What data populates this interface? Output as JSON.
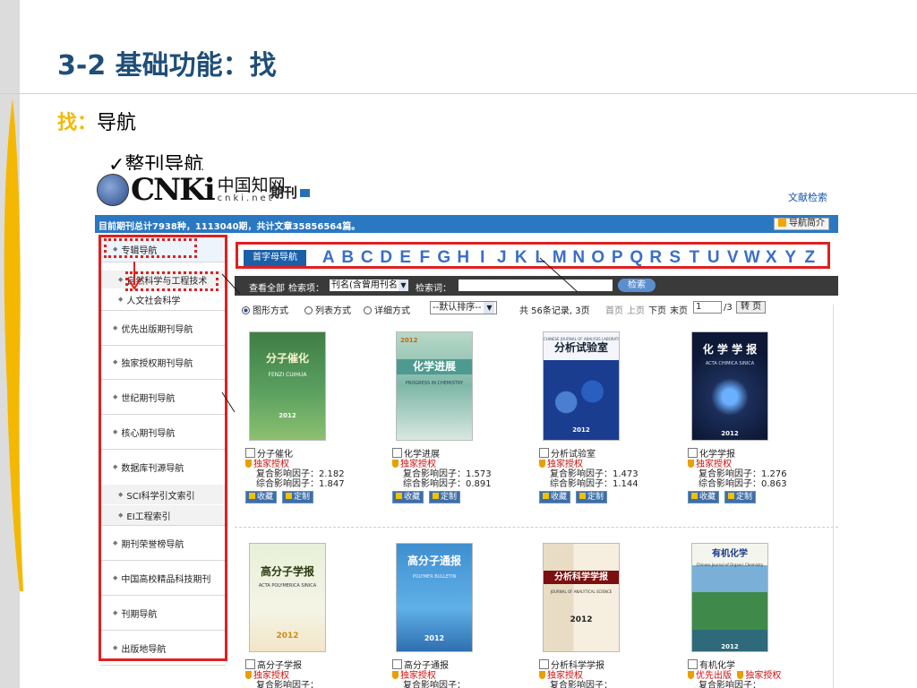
{
  "slide": {
    "title": "3-2 基础功能：找",
    "subtitle_hl": "找：",
    "subtitle": "导航",
    "check_item": "✓整刊导航"
  },
  "colors": {
    "title": "#1f4e79",
    "accent": "#f5b800",
    "annotation": "#e02020",
    "bar": "#2a78c2"
  },
  "header": {
    "logo_text": "CNKi",
    "logo_cn": "中国知网",
    "logo_url": "cnki.net",
    "section": "期刊",
    "doc_search": "文献检索",
    "stats": "目前期刊总计7938种，1113040期，共计文章35856564篇。",
    "guide_intro": "导航简介"
  },
  "sidebar": {
    "items": [
      {
        "label": "专辑导航"
      },
      {
        "label": "自然科学与工程技术"
      },
      {
        "label": "人文社会科学"
      },
      {
        "label": "优先出版期刊导航"
      },
      {
        "label": "独家授权期刊导航"
      },
      {
        "label": "世纪期刊导航"
      },
      {
        "label": "核心期刊导航"
      },
      {
        "label": "数据库刊源导航"
      },
      {
        "label": "SCI科学引文索引"
      },
      {
        "label": "EI工程索引"
      },
      {
        "label": "期刊荣誉榜导航"
      },
      {
        "label": "中国高校精品科技期刊"
      },
      {
        "label": "刊期导航"
      },
      {
        "label": "出版地导航"
      }
    ]
  },
  "letters": {
    "first_label": "首字母导航",
    "list": [
      "A",
      "B",
      "C",
      "D",
      "E",
      "F",
      "G",
      "H",
      "I",
      "J",
      "K",
      "L",
      "M",
      "N",
      "O",
      "P",
      "Q",
      "R",
      "S",
      "T",
      "U",
      "V",
      "W",
      "X",
      "Y",
      "Z"
    ]
  },
  "search": {
    "view_all": "查看全部",
    "field_label": "检索项：",
    "field_value": "刊名(含曾用刊名)",
    "keyword_label": "检索词：",
    "keyword_value": "",
    "button": "检索"
  },
  "view": {
    "graphic": "图形方式",
    "list": "列表方式",
    "detail": "详细方式",
    "sort": "--默认排序--",
    "records": "共 56条记录, 3页",
    "first": "首页",
    "prev": "上页",
    "next": "下页",
    "last": "末页",
    "page": "1",
    "total": "/3",
    "go": "转 页"
  },
  "card_labels": {
    "exclusive": "独家授权",
    "priority": "优先出版",
    "if_composite": "复合影响因子：",
    "if_combined": "综合影响因子：",
    "favorite": "收藏",
    "customize": "定制"
  },
  "journals": [
    {
      "name": "分子催化",
      "cover_title": "分子催化",
      "cover_sub": "FENZI CUIHUA",
      "cover_year": "2012",
      "composite_if": "2.182",
      "combined_if": "1.847"
    },
    {
      "name": "化学进展",
      "cover_title": "化学进展",
      "cover_sub": "PROGRESS IN CHEMISTRY",
      "cover_year": "2012",
      "composite_if": "1.573",
      "combined_if": "0.891"
    },
    {
      "name": "分析试验室",
      "cover_title": "分析试验室",
      "cover_sub": "CHINESE JOURNAL OF ANALYSIS LABORATORY",
      "cover_year": "2012",
      "composite_if": "1.473",
      "combined_if": "1.144"
    },
    {
      "name": "化学学报",
      "cover_title": "化 学 学 报",
      "cover_sub": "ACTA CHIMICA SINICA",
      "cover_year": "2012",
      "composite_if": "1.276",
      "combined_if": "0.863"
    },
    {
      "name": "高分子学报",
      "cover_title": "高分子学报",
      "cover_sub": "ACTA POLYMERICA SINICA",
      "cover_year": "2012"
    },
    {
      "name": "高分子通报",
      "cover_title": "高分子通报",
      "cover_sub": "POLYMER BULLETIN",
      "cover_year": "2012"
    },
    {
      "name": "分析科学学报",
      "cover_title": "分析科学学报",
      "cover_sub": "JOURNAL OF ANALYTICAL SCIENCE",
      "cover_year": "2012"
    },
    {
      "name": "有机化学",
      "cover_title": "有机化学",
      "cover_sub": "Chinese Journal of Organic Chemistry",
      "cover_year": "2012"
    }
  ]
}
